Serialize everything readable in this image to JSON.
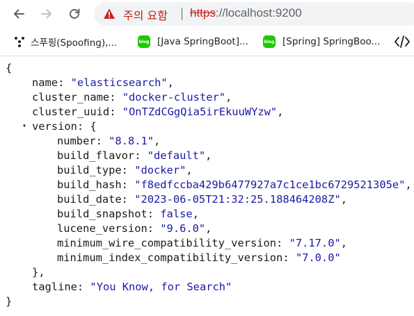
{
  "browser": {
    "warning_label": "주의 요함",
    "separator": "|",
    "url_scheme": "https",
    "url_rest": "://localhost:9200",
    "colors": {
      "warning": "#c5221f",
      "omnibox_bg": "#f1f3f4"
    },
    "icons": [
      "back-arrow-icon",
      "forward-arrow-icon",
      "reload-icon",
      "warning-triangle-icon"
    ]
  },
  "bookmarks": [
    {
      "label": "스푸핑(Spoofing),...",
      "icon": "dots-icon"
    },
    {
      "label": "[Java SpringBoot]...",
      "icon": "blog-icon",
      "icon_text": "blog"
    },
    {
      "label": "[Spring] SpringBoo...",
      "icon": "blog-icon",
      "icon_text": "blog"
    }
  ],
  "json": {
    "open_brace": "{",
    "close_brace": "}",
    "name_key": "name",
    "name_value": "\"elasticsearch\"",
    "cluster_name_key": "cluster_name",
    "cluster_name_value": "\"docker-cluster\"",
    "cluster_uuid_key": "cluster_uuid",
    "cluster_uuid_value": "\"OnTZdCGgQia5irEkuuWYzw\"",
    "version_key": "version",
    "version_open": "{",
    "version_close": "},",
    "number_key": "number",
    "number_value": "\"8.8.1\"",
    "build_flavor_key": "build_flavor",
    "build_flavor_value": "\"default\"",
    "build_type_key": "build_type",
    "build_type_value": "\"docker\"",
    "build_hash_key": "build_hash",
    "build_hash_value": "\"f8edfccba429b6477927a7c1ce1bc6729521305e\"",
    "build_date_key": "build_date",
    "build_date_value": "\"2023-06-05T21:32:25.188464208Z\"",
    "build_snapshot_key": "build_snapshot",
    "build_snapshot_value": "false",
    "lucene_version_key": "lucene_version",
    "lucene_version_value": "\"9.6.0\"",
    "min_wire_key": "minimum_wire_compatibility_version",
    "min_wire_value": "\"7.17.0\"",
    "min_index_key": "minimum_index_compatibility_version",
    "min_index_value": "\"7.0.0\"",
    "tagline_key": "tagline",
    "tagline_value": "\"You Know, for Search\"",
    "toggle_glyph": "▾"
  }
}
